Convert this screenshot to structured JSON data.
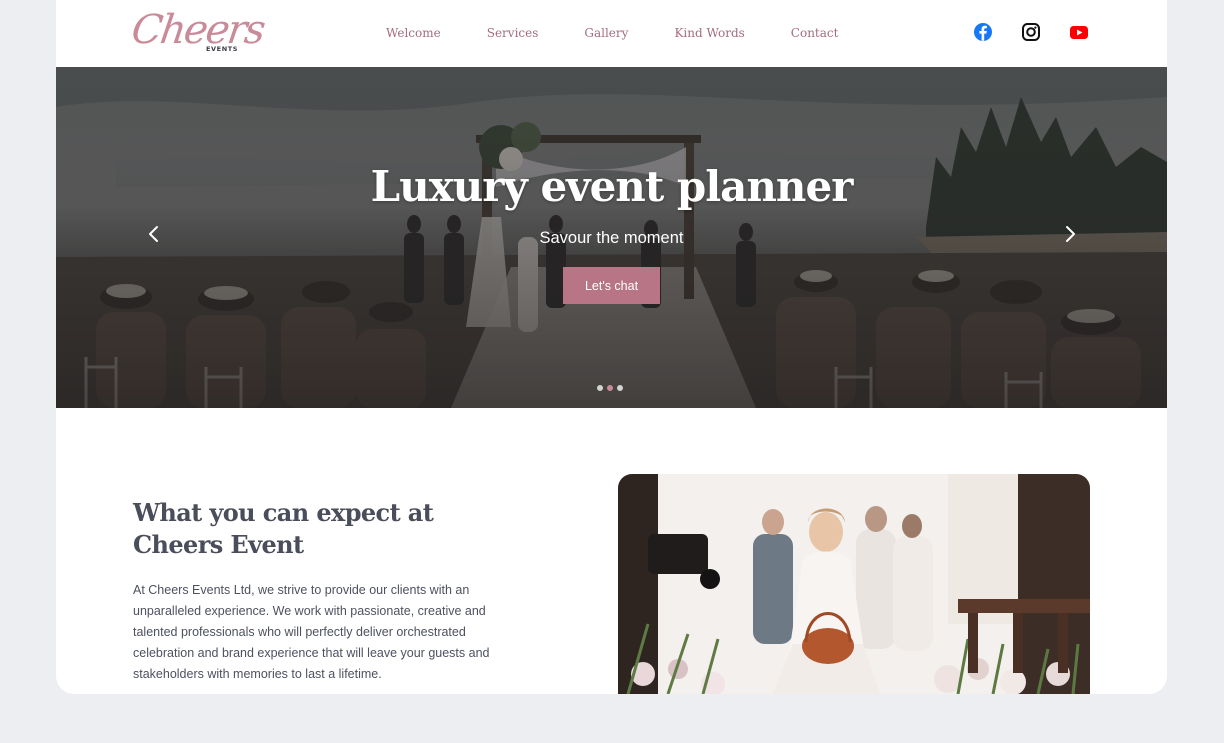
{
  "brand": {
    "logo_script": "Cheers",
    "logo_sub": "EVENTS"
  },
  "nav": {
    "items": [
      {
        "label": "Welcome"
      },
      {
        "label": "Services"
      },
      {
        "label": "Gallery"
      },
      {
        "label": "Kind Words"
      },
      {
        "label": "Contact"
      }
    ]
  },
  "social": {
    "icons": [
      "facebook-icon",
      "instagram-icon",
      "youtube-icon"
    ]
  },
  "hero": {
    "title": "Luxury event planner",
    "subtitle": "Savour the moment",
    "cta_label": "Let's chat",
    "slides_total": 3,
    "active_slide": 2
  },
  "intro": {
    "heading": "What you can expect at Cheers Event",
    "body": "At Cheers Events Ltd, we strive to provide our clients with an unparalleled experience. We work with passionate, creative and talented professionals who will perfectly deliver orchestrated celebration and brand experience that will leave your guests and stakeholders with memories to last a lifetime."
  },
  "colors": {
    "accent": "#b87586",
    "nav_text": "#a46c7f",
    "heading_text": "#4a4d5a",
    "page_bg": "#eceef2",
    "facebook": "#1877f2",
    "youtube": "#ff0000"
  }
}
